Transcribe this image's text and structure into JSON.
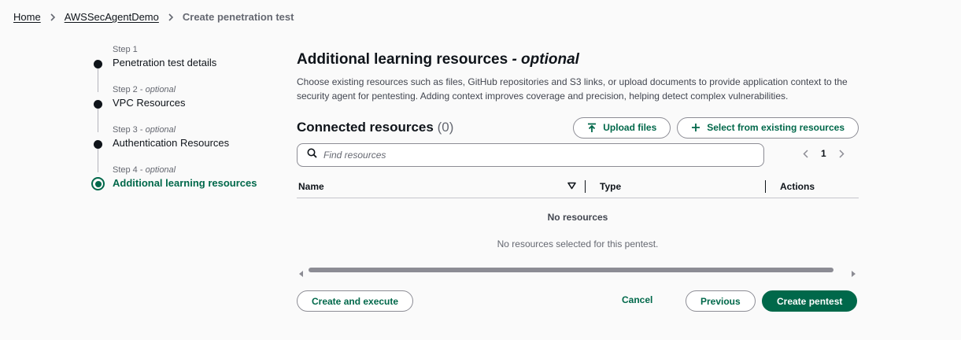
{
  "breadcrumb": {
    "home": "Home",
    "agent": "AWSSecAgentDemo",
    "current": "Create penetration test"
  },
  "steps": [
    {
      "num": "Step 1",
      "optional": "",
      "label": "Penetration test details"
    },
    {
      "num": "Step 2 - ",
      "optional": "optional",
      "label": "VPC Resources"
    },
    {
      "num": "Step 3 - ",
      "optional": "optional",
      "label": "Authentication Resources"
    },
    {
      "num": "Step 4 - ",
      "optional": "optional",
      "label": "Additional learning resources"
    }
  ],
  "main": {
    "title": "Additional learning resources",
    "title_suffix": "- optional",
    "description": "Choose existing resources such as files, GitHub repositories and S3 links, or upload documents to provide application context to the security agent for pentesting. Adding context improves coverage and precision, helping detect complex vulnerabilities."
  },
  "resources": {
    "heading": "Connected resources",
    "count": "(0)",
    "upload_label": "Upload files",
    "select_label": "Select from existing resources"
  },
  "search": {
    "placeholder": "Find resources"
  },
  "pagination": {
    "page": "1"
  },
  "table": {
    "columns": [
      "Name",
      "Type",
      "Actions"
    ],
    "empty_title": "No resources",
    "empty_message": "No resources selected for this pentest."
  },
  "footer": {
    "create_execute": "Create and execute",
    "cancel": "Cancel",
    "previous": "Previous",
    "create": "Create pentest"
  },
  "colors": {
    "accent": "#00684a",
    "text": "#0f141a",
    "muted": "#656871"
  }
}
